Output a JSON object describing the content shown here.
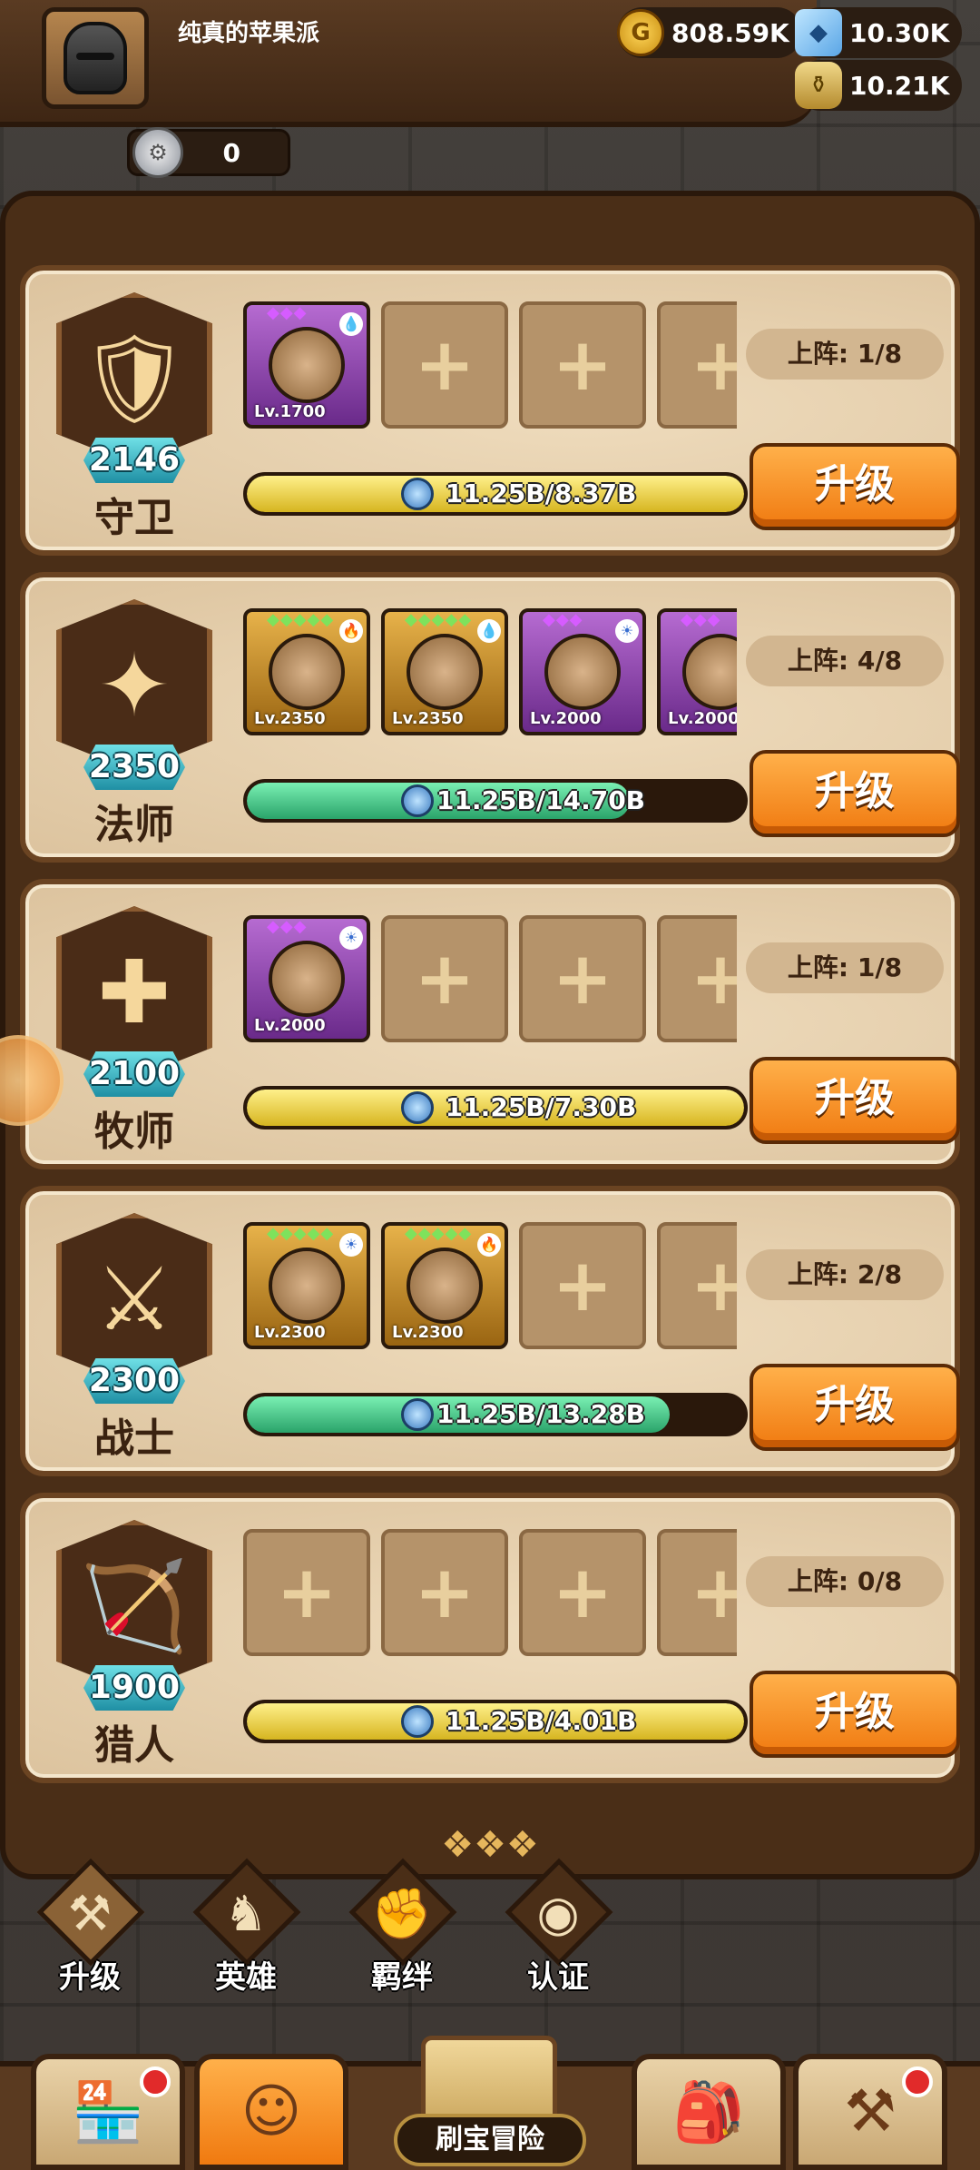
{
  "header": {
    "username": "纯真的苹果派",
    "gold": "808.59K",
    "gems": "10.30K",
    "potion": "10.21K",
    "silver": "0"
  },
  "classes": [
    {
      "name": "守卫",
      "level": "2146",
      "deploy": "上阵: 1/8",
      "progress_text": "11.25B/8.37B",
      "progress": 1.0,
      "bar_color": "yellow",
      "icon": "shield-icon",
      "glyph": "🛡",
      "heroes": [
        {
          "lv": "Lv.1700",
          "rarity": "purple",
          "stars": "◆◆◆",
          "elem": "💧"
        }
      ]
    },
    {
      "name": "法师",
      "level": "2350",
      "deploy": "上阵: 4/8",
      "progress_text": "11.25B/14.70B",
      "progress": 0.77,
      "bar_color": "green",
      "icon": "staff-icon",
      "glyph": "✦",
      "heroes": [
        {
          "lv": "Lv.2350",
          "rarity": "gold",
          "stars": "◆◆◆◆◆",
          "elem": "🔥"
        },
        {
          "lv": "Lv.2350",
          "rarity": "gold",
          "stars": "◆◆◆◆◆",
          "elem": "💧"
        },
        {
          "lv": "Lv.2000",
          "rarity": "purple",
          "stars": "◆◆◆",
          "elem": "☀"
        },
        {
          "lv": "Lv.2000",
          "rarity": "purple",
          "stars": "◆◆◆",
          "elem": "☀"
        }
      ]
    },
    {
      "name": "牧师",
      "level": "2100",
      "deploy": "上阵: 1/8",
      "progress_text": "11.25B/7.30B",
      "progress": 1.0,
      "bar_color": "yellow",
      "icon": "cross-icon",
      "glyph": "✚",
      "heroes": [
        {
          "lv": "Lv.2000",
          "rarity": "purple",
          "stars": "◆◆◆",
          "elem": "☀"
        }
      ]
    },
    {
      "name": "战士",
      "level": "2300",
      "deploy": "上阵: 2/8",
      "progress_text": "11.25B/13.28B",
      "progress": 0.85,
      "bar_color": "green",
      "icon": "sword-icon",
      "glyph": "⚔",
      "heroes": [
        {
          "lv": "Lv.2300",
          "rarity": "gold",
          "stars": "◆◆◆◆◆",
          "elem": "☀"
        },
        {
          "lv": "Lv.2300",
          "rarity": "gold",
          "stars": "◆◆◆◆◆",
          "elem": "🔥"
        }
      ]
    },
    {
      "name": "猎人",
      "level": "1900",
      "deploy": "上阵: 0/8",
      "progress_text": "11.25B/4.01B",
      "progress": 1.0,
      "bar_color": "yellow",
      "icon": "bow-icon",
      "glyph": "🏹",
      "heroes": []
    }
  ],
  "upgrade_label": "升级",
  "tabs": [
    {
      "label": "升级",
      "icon": "sword-upgrade-icon",
      "glyph": "⚒",
      "active": true
    },
    {
      "label": "英雄",
      "icon": "hero-icon",
      "glyph": "♞",
      "active": false
    },
    {
      "label": "羁绊",
      "icon": "fist-icon",
      "glyph": "✊",
      "active": false
    },
    {
      "label": "认证",
      "icon": "eye-icon",
      "glyph": "◉",
      "active": false
    }
  ],
  "bottom_nav": {
    "shop_icon": "shop-icon",
    "heroes_icon": "hero-portrait-icon",
    "map_label": "刷宝冒险",
    "bag_icon": "backpack-icon",
    "forge_icon": "hammer-icon"
  },
  "colors": {
    "upgrade_button": "#f07a10",
    "level_badge": "#1f8fa4",
    "bar_yellow": "#d6b520",
    "bar_green": "#2aa36a"
  }
}
